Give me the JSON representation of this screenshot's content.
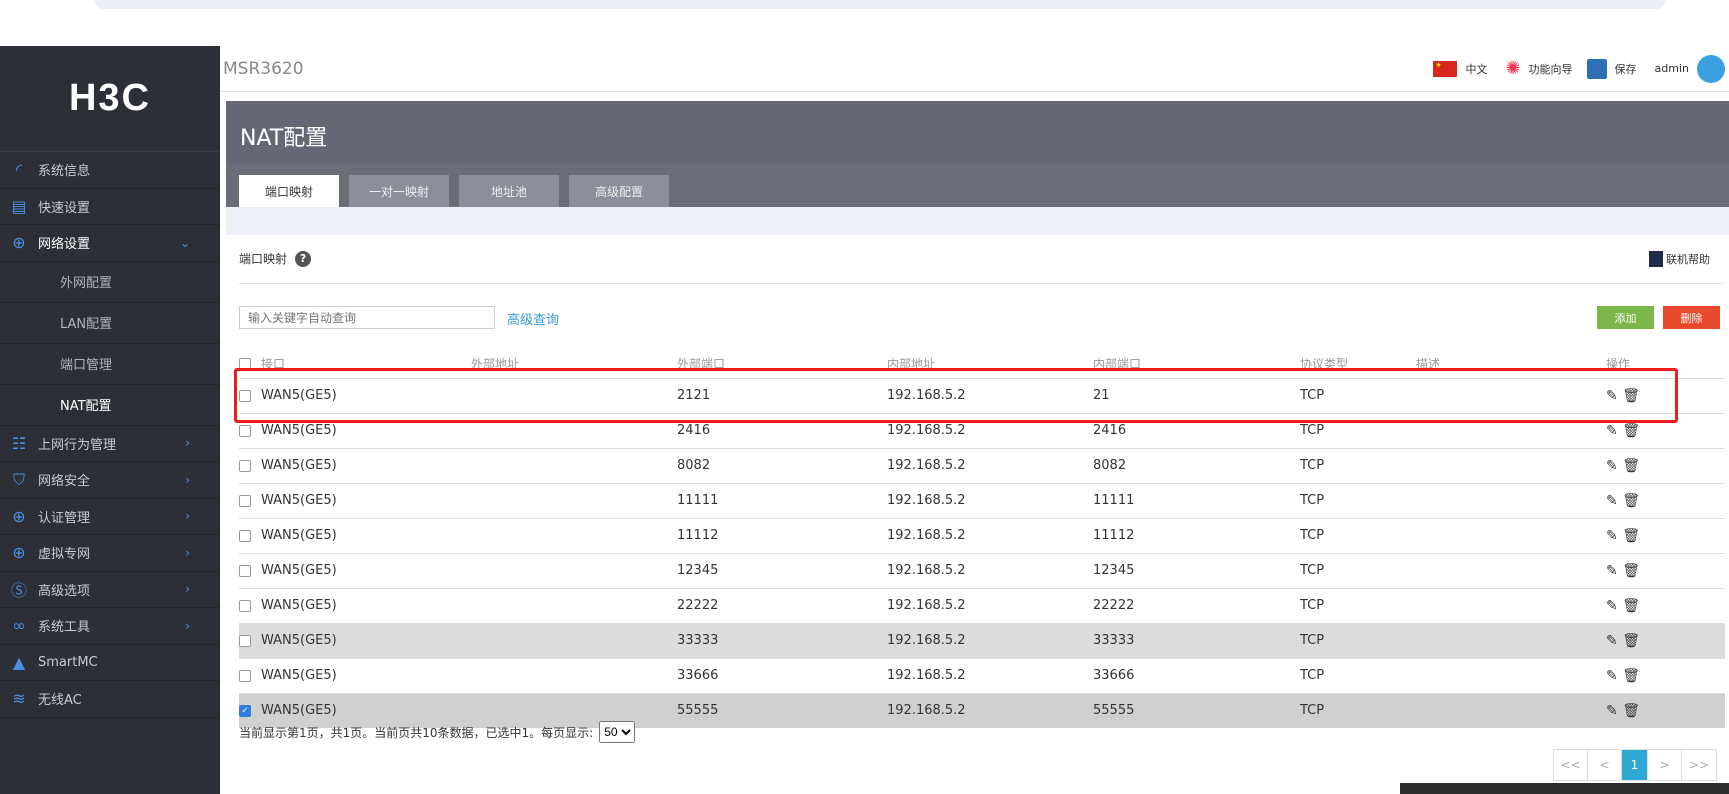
{
  "app": {
    "logo": "H3C",
    "model": "MSR3620"
  },
  "topbar": {
    "language": "中文",
    "wizard": "功能向导",
    "save": "保存",
    "user": "admin"
  },
  "sidebar": {
    "items": [
      {
        "label": "系统信息",
        "icon": "gauge-icon"
      },
      {
        "label": "快速设置",
        "icon": "document-wrench-icon"
      },
      {
        "label": "网络设置",
        "icon": "globe-icon",
        "expanded": true
      },
      {
        "label": "外网配置",
        "sub": true
      },
      {
        "label": "LAN配置",
        "sub": true
      },
      {
        "label": "端口管理",
        "sub": true
      },
      {
        "label": "NAT配置",
        "sub": true,
        "active": true
      },
      {
        "label": "上网行为管理",
        "icon": "network-icon"
      },
      {
        "label": "网络安全",
        "icon": "shield-wifi-icon"
      },
      {
        "label": "认证管理",
        "icon": "globe-icon"
      },
      {
        "label": "虚拟专网",
        "icon": "globe-user-icon"
      },
      {
        "label": "高级选项",
        "icon": "s-icon"
      },
      {
        "label": "系统工具",
        "icon": "link-icon"
      },
      {
        "label": "SmartMC",
        "icon": "triangle-icon"
      },
      {
        "label": "无线AC",
        "icon": "wifi-icon"
      }
    ]
  },
  "page": {
    "title": "NAT配置",
    "tabs": [
      "端口映射",
      "一对一映射",
      "地址池",
      "高级配置"
    ],
    "active_tab": 0
  },
  "section": {
    "title": "端口映射",
    "online_help": "联机帮助",
    "search_placeholder": "输入关键字自动查询",
    "advanced_search": "高级查询",
    "add": "添加",
    "delete": "删除"
  },
  "table": {
    "headers": [
      "接口",
      "外部地址",
      "外部端口",
      "内部地址",
      "内部端口",
      "协议类型",
      "描述",
      "操作"
    ],
    "rows": [
      {
        "iface": "WAN5(GE5)",
        "ext_addr": "",
        "ext_port": "2121",
        "int_addr": "192.168.5.2",
        "int_port": "21",
        "proto": "TCP",
        "desc": "",
        "checked": false
      },
      {
        "iface": "WAN5(GE5)",
        "ext_addr": "",
        "ext_port": "2416",
        "int_addr": "192.168.5.2",
        "int_port": "2416",
        "proto": "TCP",
        "desc": "",
        "checked": false
      },
      {
        "iface": "WAN5(GE5)",
        "ext_addr": "",
        "ext_port": "8082",
        "int_addr": "192.168.5.2",
        "int_port": "8082",
        "proto": "TCP",
        "desc": "",
        "checked": false
      },
      {
        "iface": "WAN5(GE5)",
        "ext_addr": "",
        "ext_port": "11111",
        "int_addr": "192.168.5.2",
        "int_port": "11111",
        "proto": "TCP",
        "desc": "",
        "checked": false
      },
      {
        "iface": "WAN5(GE5)",
        "ext_addr": "",
        "ext_port": "11112",
        "int_addr": "192.168.5.2",
        "int_port": "11112",
        "proto": "TCP",
        "desc": "",
        "checked": false
      },
      {
        "iface": "WAN5(GE5)",
        "ext_addr": "",
        "ext_port": "12345",
        "int_addr": "192.168.5.2",
        "int_port": "12345",
        "proto": "TCP",
        "desc": "",
        "checked": false
      },
      {
        "iface": "WAN5(GE5)",
        "ext_addr": "",
        "ext_port": "22222",
        "int_addr": "192.168.5.2",
        "int_port": "22222",
        "proto": "TCP",
        "desc": "",
        "checked": false
      },
      {
        "iface": "WAN5(GE5)",
        "ext_addr": "",
        "ext_port": "33333",
        "int_addr": "192.168.5.2",
        "int_port": "33333",
        "proto": "TCP",
        "desc": "",
        "checked": false,
        "hover": true
      },
      {
        "iface": "WAN5(GE5)",
        "ext_addr": "",
        "ext_port": "33666",
        "int_addr": "192.168.5.2",
        "int_port": "33666",
        "proto": "TCP",
        "desc": "",
        "checked": false
      },
      {
        "iface": "WAN5(GE5)",
        "ext_addr": "",
        "ext_port": "55555",
        "int_addr": "192.168.5.2",
        "int_port": "55555",
        "proto": "TCP",
        "desc": "",
        "checked": true
      }
    ]
  },
  "footer": {
    "summary": "当前显示第1页，共1页。当前页共10条数据，已选中1。每页显示:",
    "page_size": "50"
  },
  "pager": {
    "first": "<<",
    "prev": "<",
    "current": "1",
    "next": ">",
    "last": ">>"
  },
  "colors": {
    "sidebar": "#2c2f36",
    "accent": "#4a90e2",
    "add": "#7ab648",
    "delete": "#e8482c",
    "highlight": "#ee1c1c"
  }
}
